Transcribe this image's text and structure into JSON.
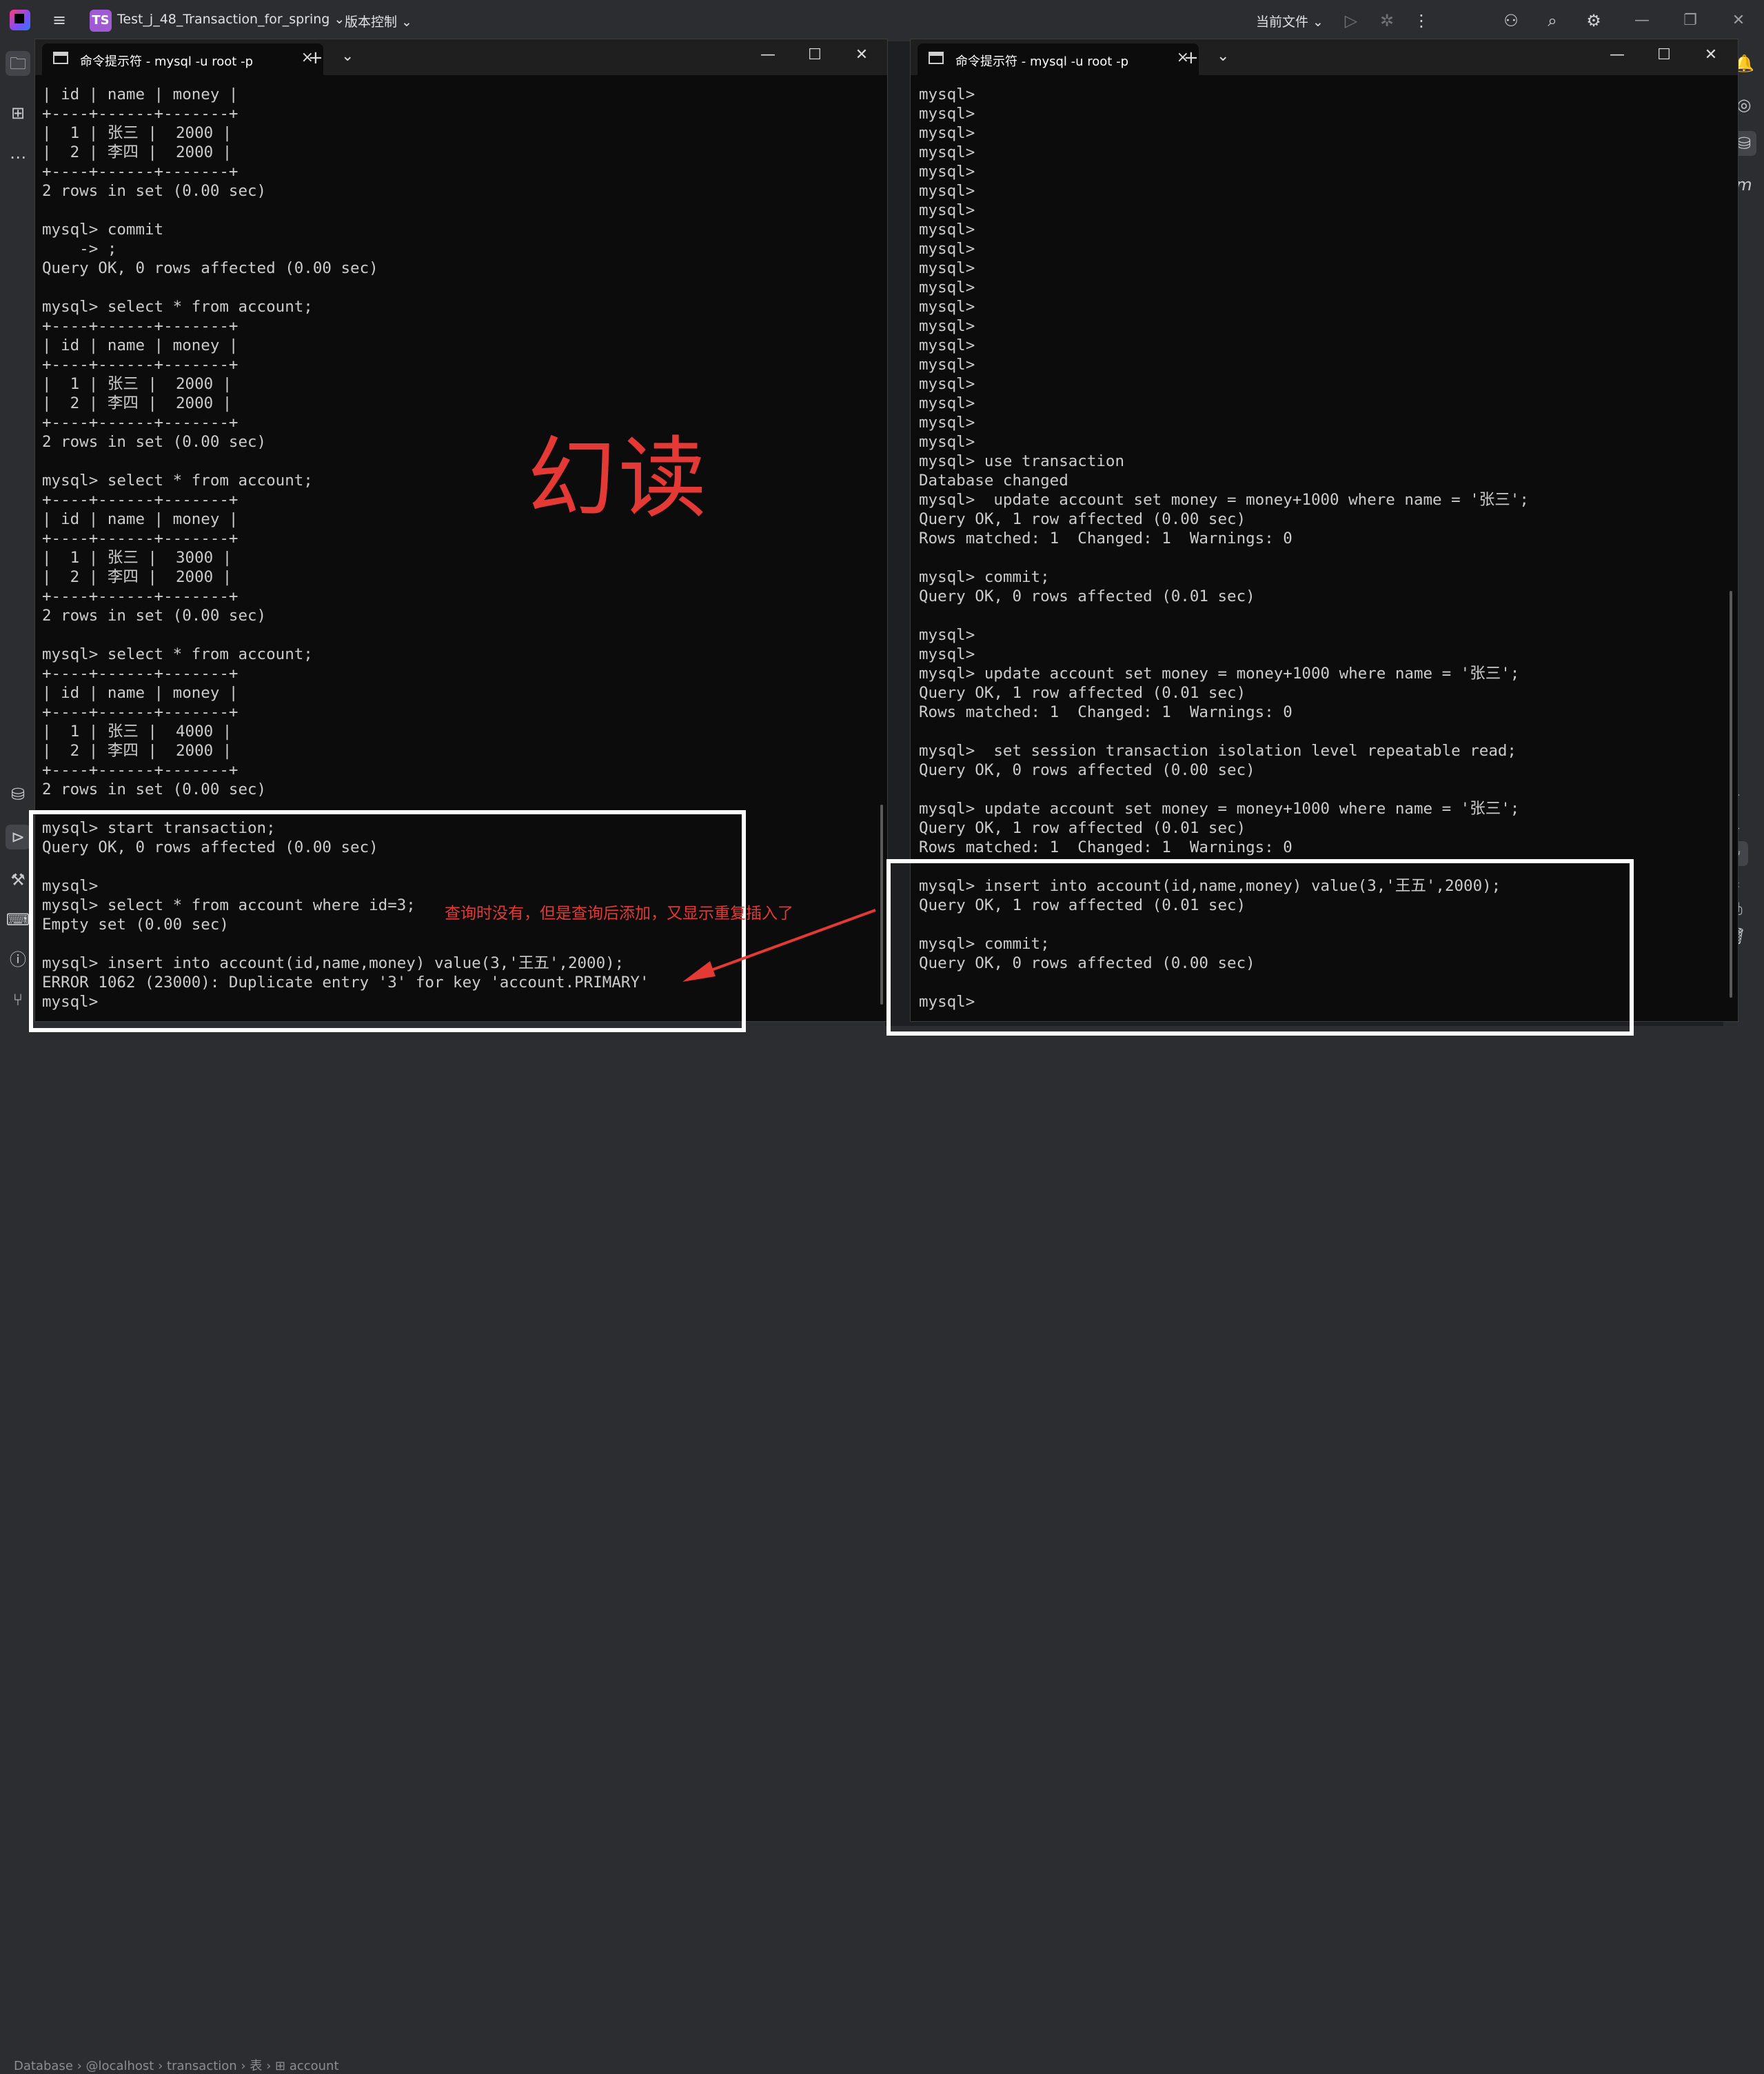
{
  "ide": {
    "project_badge": "TS",
    "project_name": "Test_j_48_Transaction_for_spring",
    "vcs_label": "版本控制",
    "current_file_label": "当前文件",
    "breadcrumb": [
      "Database",
      "@localhost",
      "transaction",
      "表",
      "account"
    ]
  },
  "left_terminal": {
    "tab_title": "命令提示符 - mysql  -u root -p",
    "lines": [
      "| id | name | money |",
      "+----+------+-------+",
      "|  1 | 张三 |  2000 |",
      "|  2 | 李四 |  2000 |",
      "+----+------+-------+",
      "2 rows in set (0.00 sec)",
      "",
      "mysql> commit",
      "    -> ;",
      "Query OK, 0 rows affected (0.00 sec)",
      "",
      "mysql> select * from account;",
      "+----+------+-------+",
      "| id | name | money |",
      "+----+------+-------+",
      "|  1 | 张三 |  2000 |",
      "|  2 | 李四 |  2000 |",
      "+----+------+-------+",
      "2 rows in set (0.00 sec)",
      "",
      "mysql> select * from account;",
      "+----+------+-------+",
      "| id | name | money |",
      "+----+------+-------+",
      "|  1 | 张三 |  3000 |",
      "|  2 | 李四 |  2000 |",
      "+----+------+-------+",
      "2 rows in set (0.00 sec)",
      "",
      "mysql> select * from account;",
      "+----+------+-------+",
      "| id | name | money |",
      "+----+------+-------+",
      "|  1 | 张三 |  4000 |",
      "|  2 | 李四 |  2000 |",
      "+----+------+-------+",
      "2 rows in set (0.00 sec)",
      "",
      "mysql> start transaction;",
      "Query OK, 0 rows affected (0.00 sec)",
      "",
      "mysql>",
      "mysql> select * from account where id=3;",
      "Empty set (0.00 sec)",
      "",
      "mysql> insert into account(id,name,money) value(3,'王五',2000);",
      "ERROR 1062 (23000): Duplicate entry '3' for key 'account.PRIMARY'",
      "mysql>"
    ]
  },
  "right_terminal": {
    "tab_title": "命令提示符 - mysql  -u root -p",
    "lines": [
      "mysql>",
      "mysql>",
      "mysql>",
      "mysql>",
      "mysql>",
      "mysql>",
      "mysql>",
      "mysql>",
      "mysql>",
      "mysql>",
      "mysql>",
      "mysql>",
      "mysql>",
      "mysql>",
      "mysql>",
      "mysql>",
      "mysql>",
      "mysql>",
      "mysql>",
      "mysql> use transaction",
      "Database changed",
      "mysql>  update account set money = money+1000 where name = '张三';",
      "Query OK, 1 row affected (0.00 sec)",
      "Rows matched: 1  Changed: 1  Warnings: 0",
      "",
      "mysql> commit;",
      "Query OK, 0 rows affected (0.01 sec)",
      "",
      "mysql>",
      "mysql>",
      "mysql> update account set money = money+1000 where name = '张三';",
      "Query OK, 1 row affected (0.01 sec)",
      "Rows matched: 1  Changed: 1  Warnings: 0",
      "",
      "mysql>  set session transaction isolation level repeatable read;",
      "Query OK, 0 rows affected (0.00 sec)",
      "",
      "mysql> update account set money = money+1000 where name = '张三';",
      "Query OK, 1 row affected (0.01 sec)",
      "Rows matched: 1  Changed: 1  Warnings: 0",
      "",
      "mysql> insert into account(id,name,money) value(3,'王五',2000);",
      "Query OK, 1 row affected (0.01 sec)",
      "",
      "mysql> commit;",
      "Query OK, 0 rows affected (0.00 sec)",
      "",
      "mysql>"
    ]
  },
  "annotations": {
    "title": "幻读",
    "note": "查询时没有，但是查询后添加，又显示重复插入了",
    "accent_color": "#e53935"
  }
}
